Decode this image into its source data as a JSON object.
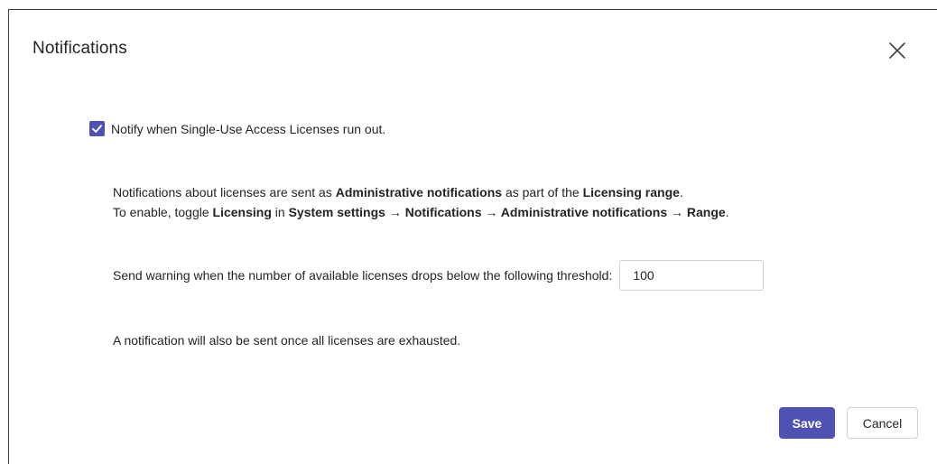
{
  "dialog": {
    "title": "Notifications",
    "close_icon": "close-icon"
  },
  "notify_option": {
    "checked": true,
    "label": "Notify when Single-Use Access Licenses run out."
  },
  "info": {
    "line1": {
      "t1": "Notifications about licenses are sent as ",
      "b1": "Administrative notifications",
      "t2": " as part of the ",
      "b2": "Licensing range",
      "t3": "."
    },
    "line2": {
      "t1": "To enable, toggle ",
      "b1": "Licensing",
      "t2": " in ",
      "b2": "System settings → Notifications → Administrative notifications → Range",
      "t3": "."
    }
  },
  "threshold": {
    "label": "Send warning when the number of available licenses drops below the following threshold:",
    "value": "100"
  },
  "exhausted_note": "A notification will also be sent once all licenses are exhausted.",
  "buttons": {
    "save_label": "Save",
    "cancel_label": "Cancel"
  },
  "colors": {
    "accent": "#4f52b2",
    "text": "#242424",
    "border": "#d1d1d1"
  }
}
